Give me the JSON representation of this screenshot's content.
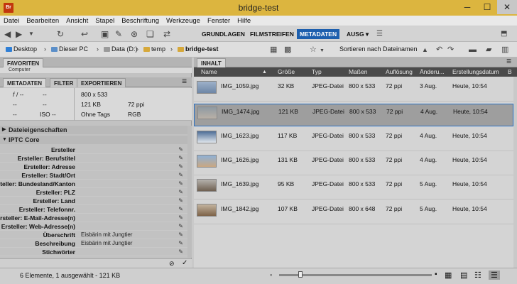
{
  "window": {
    "title": "bridge-test",
    "app_icon": "Br",
    "minimize": "─",
    "maximize": "☐",
    "close": "✕"
  },
  "menu": [
    "Datei",
    "Bearbeiten",
    "Ansicht",
    "Stapel",
    "Beschriftung",
    "Werkzeuge",
    "Fenster",
    "Hilfe"
  ],
  "workspaces": {
    "items": [
      "GRUNDLAGEN",
      "FILMSTREIFEN",
      "METADATEN",
      "AUSG ▾"
    ],
    "active": "METADATEN"
  },
  "search": {
    "placeholder": "⌕▾"
  },
  "path": {
    "items": [
      "Desktop",
      "Dieser PC",
      "Data (D:)",
      "temp",
      "bridge-test"
    ],
    "sort": "Sortieren nach Dateinamen"
  },
  "left_panel": {
    "fav_tab": "FAVORITEN",
    "fav_item": "Computer",
    "tabs": [
      "METADATEN",
      "FILTER",
      "EXPORTIEREN"
    ],
    "summary": {
      "aperture": "𝑓 / --",
      "shutter": "--",
      "c1": "--",
      "c2": "--",
      "c3": "--",
      "iso": "ISO --",
      "dimensions": "800 x 533",
      "size": "121 KB",
      "resolution": "72 ppi",
      "tags": "Ohne Tags",
      "color_mode": "RGB"
    },
    "sections": {
      "file": "Dateieigenschaften",
      "iptc": "IPTC Core"
    },
    "iptc_rows": [
      {
        "label": "Ersteller",
        "value": ""
      },
      {
        "label": "Ersteller: Berufstitel",
        "value": ""
      },
      {
        "label": "Ersteller: Adresse",
        "value": ""
      },
      {
        "label": "Ersteller: Stadt/Ort",
        "value": ""
      },
      {
        "label": "Ersteller: Bundesland/Kanton",
        "value": ""
      },
      {
        "label": "Ersteller: PLZ",
        "value": ""
      },
      {
        "label": "Ersteller: Land",
        "value": ""
      },
      {
        "label": "Ersteller: Telefonnr.",
        "value": ""
      },
      {
        "label": "Ersteller: E-Mail-Adresse(n)",
        "value": ""
      },
      {
        "label": "Ersteller: Web-Adresse(n)",
        "value": ""
      },
      {
        "label": "Überschrift",
        "value": "Eisbärin mit Jungtier"
      },
      {
        "label": "Beschreibung",
        "value": "Eisbärin mit Jungtier"
      },
      {
        "label": "Stichwörter",
        "value": ""
      }
    ]
  },
  "content": {
    "tab": "INHALT",
    "columns": [
      "Name",
      "Größe",
      "Typ",
      "Maßen",
      "Auflösung",
      "Änderu...",
      "Erstellungsdatum",
      "B"
    ],
    "files": [
      {
        "name": "IMG_1059.jpg",
        "size": "32 KB",
        "type": "JPEG-Datei",
        "dims": "800 x 533",
        "res": "72 ppi",
        "mod": "3 Aug.",
        "created": "Heute, 10:54",
        "thumb": "#7d95b5"
      },
      {
        "name": "IMG_1474.jpg",
        "size": "121 KB",
        "type": "JPEG-Datei",
        "dims": "800 x 533",
        "res": "72 ppi",
        "mod": "4 Aug.",
        "created": "Heute, 10:54",
        "thumb": "#9aa3a8"
      },
      {
        "name": "IMG_1623.jpg",
        "size": "117 KB",
        "type": "JPEG-Datei",
        "dims": "800 x 533",
        "res": "72 ppi",
        "mod": "4 Aug.",
        "created": "Heute, 10:54",
        "thumb": "#5d7fa8"
      },
      {
        "name": "IMG_1626.jpg",
        "size": "131 KB",
        "type": "JPEG-Datei",
        "dims": "800 x 533",
        "res": "72 ppi",
        "mod": "4 Aug.",
        "created": "Heute, 10:54",
        "thumb": "#7fa0c4"
      },
      {
        "name": "IMG_1639.jpg",
        "size": "95 KB",
        "type": "JPEG-Datei",
        "dims": "800 x 533",
        "res": "72 ppi",
        "mod": "5 Aug.",
        "created": "Heute, 10:54",
        "thumb": "#8d8070"
      },
      {
        "name": "IMG_1842.jpg",
        "size": "107 KB",
        "type": "JPEG-Datei",
        "dims": "800 x 648",
        "res": "72 ppi",
        "mod": "5 Aug.",
        "created": "Heute, 10:54",
        "thumb": "#a08a70"
      }
    ],
    "selected_index": 1
  },
  "status": {
    "text": "6 Elemente, 1 ausgewählt - 121 KB",
    "zoom": 0.14
  },
  "colors": {
    "accent": "#1d5fae",
    "title_bar": "#dcb53f",
    "selection_border": "#2a71c4"
  }
}
